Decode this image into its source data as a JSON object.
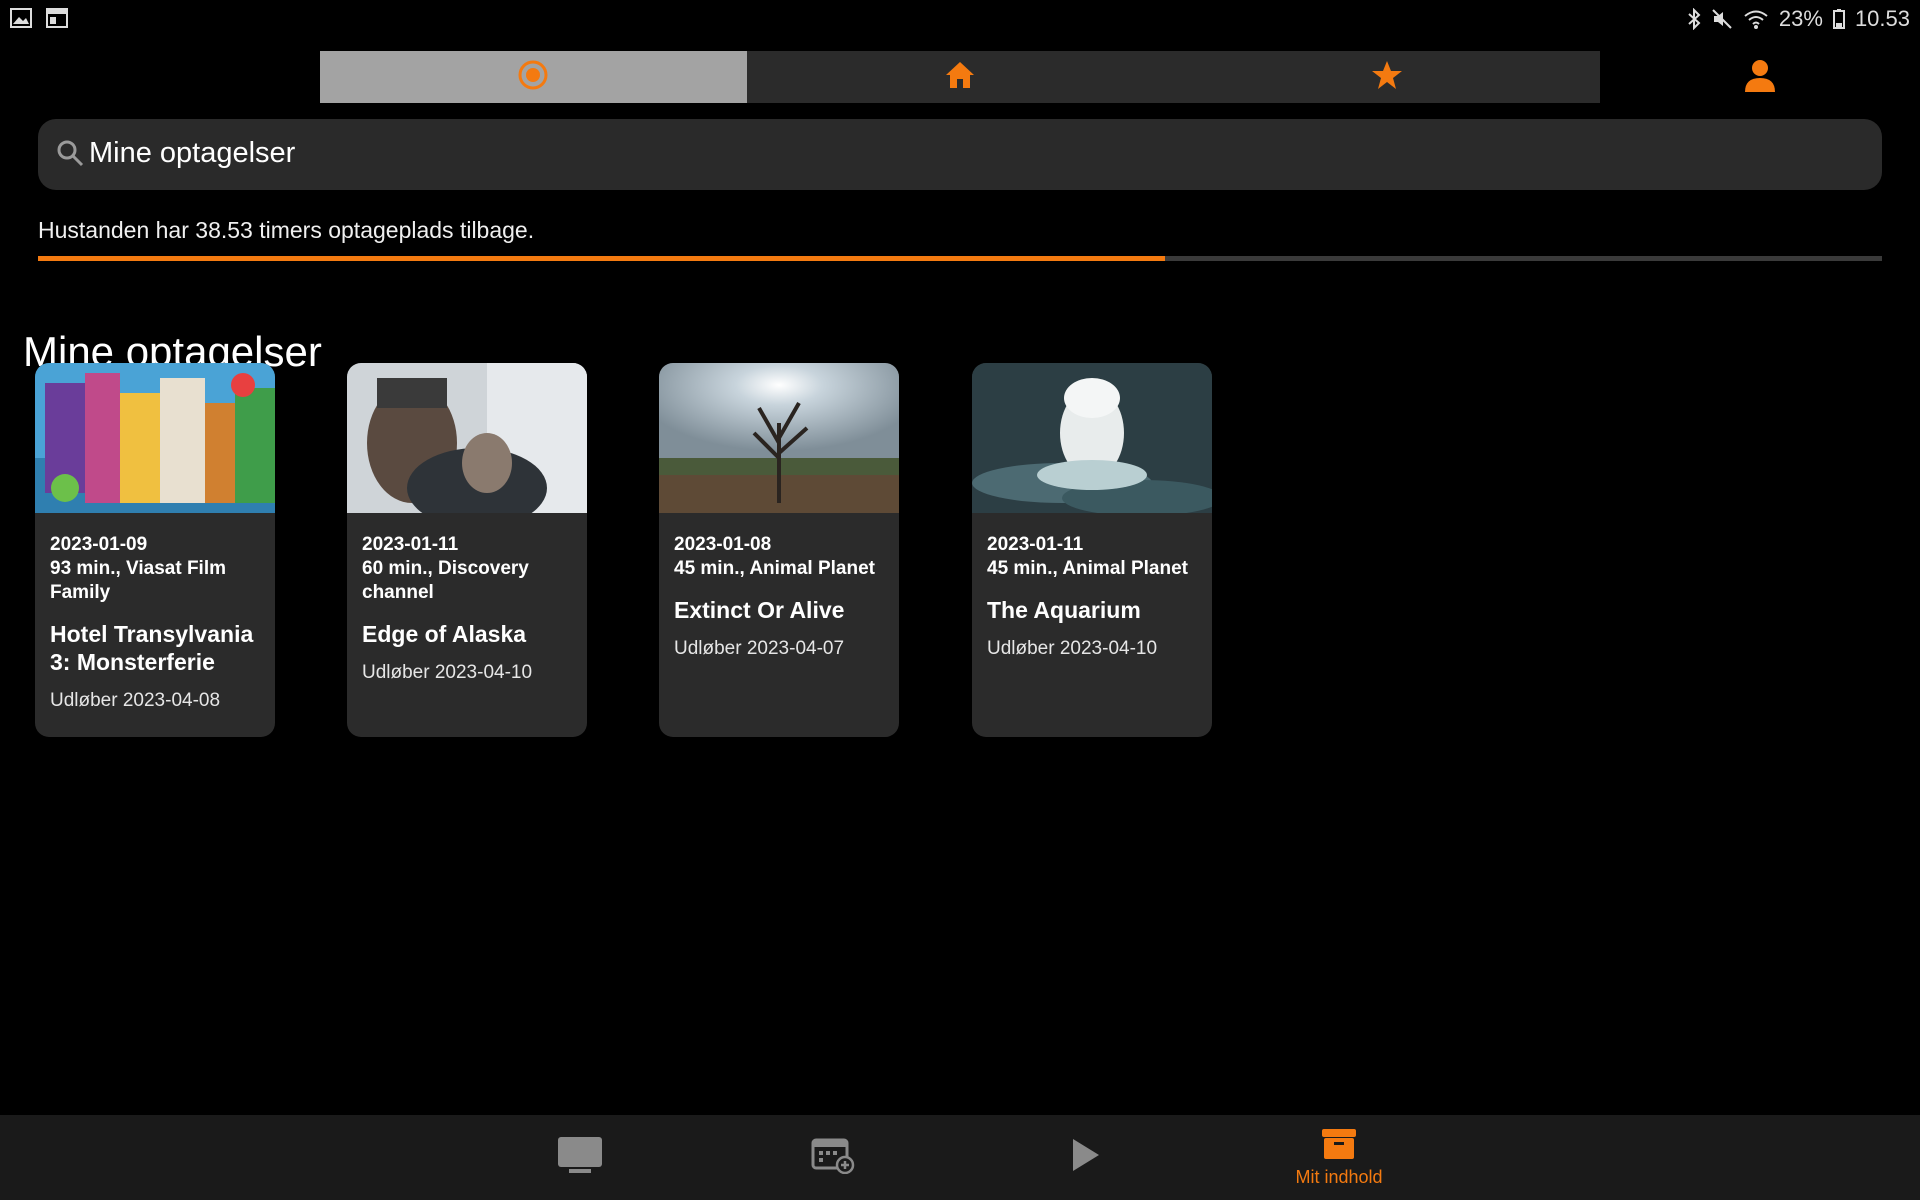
{
  "status_bar": {
    "battery_percent": "23%",
    "time": "10.53",
    "icons": [
      "gallery-icon",
      "screen-icon",
      "bluetooth-icon",
      "mute-icon",
      "wifi-icon",
      "battery-icon"
    ]
  },
  "top_tabs": [
    {
      "name": "recordings",
      "icon": "record-icon",
      "active": true
    },
    {
      "name": "home",
      "icon": "home-icon",
      "active": false
    },
    {
      "name": "favorites",
      "icon": "star-icon",
      "active": false
    }
  ],
  "profile": {
    "icon": "person-icon"
  },
  "search": {
    "value": "Mine optagelser",
    "icon": "search-icon"
  },
  "quota": {
    "text": "Hustanden har 38.53 timers optageplads tilbage.",
    "fill_fraction": 0.611
  },
  "section": {
    "title": "Mine optagelser"
  },
  "recordings": [
    {
      "date": "2023-01-09",
      "meta": "93 min., Viasat Film Family",
      "title": "Hotel Transylvania 3: Monsterferie",
      "expiry": "Udløber 2023-04-08"
    },
    {
      "date": "2023-01-11",
      "meta": "60 min., Discovery channel",
      "title": "Edge of Alaska",
      "expiry": "Udløber 2023-04-10"
    },
    {
      "date": "2023-01-08",
      "meta": "45 min., Animal Planet",
      "title": "Extinct Or Alive",
      "expiry": "Udløber 2023-04-07"
    },
    {
      "date": "2023-01-11",
      "meta": "45 min., Animal Planet",
      "title": "The Aquarium",
      "expiry": "Udløber 2023-04-10"
    }
  ],
  "bottom_nav": [
    {
      "icon": "tv-icon",
      "label": "",
      "active": false
    },
    {
      "icon": "calendar-add-icon",
      "label": "",
      "active": false
    },
    {
      "icon": "play-icon",
      "label": "",
      "active": false
    },
    {
      "icon": "archive-box-icon",
      "label": "Mit indhold",
      "active": true
    }
  ],
  "colors": {
    "accent": "#f47a10",
    "background": "#000000",
    "card": "#2b2b2b",
    "tab_active": "#a3a3a3"
  }
}
